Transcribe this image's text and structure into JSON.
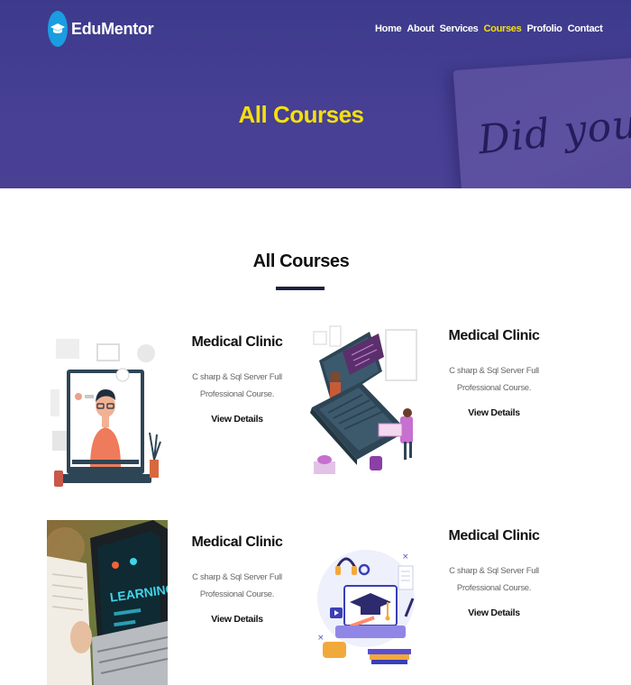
{
  "brand": {
    "name": "EduMentor"
  },
  "nav": {
    "items": [
      {
        "label": "Home",
        "active": false
      },
      {
        "label": "About",
        "active": false
      },
      {
        "label": "Services",
        "active": false
      },
      {
        "label": "Courses",
        "active": true
      },
      {
        "label": "Profolio",
        "active": false
      },
      {
        "label": "Contact",
        "active": false
      }
    ]
  },
  "hero": {
    "title": "All Courses",
    "background_text": "Did you kno"
  },
  "section": {
    "title": "All Courses"
  },
  "courses": [
    {
      "title": "Medical Clinic",
      "description": "C sharp & Sql Server Full Professional Course.",
      "link": "View Details",
      "image": "video-call-illustration"
    },
    {
      "title": "Medical Clinic",
      "description": "C sharp & Sql Server Full Professional Course.",
      "link": "View Details",
      "image": "online-teacher-laptop-illustration"
    },
    {
      "title": "Medical Clinic",
      "description": "C sharp & Sql Server Full Professional Course.",
      "link": "View Details",
      "image": "learning-laptop-photo"
    },
    {
      "title": "Medical Clinic",
      "description": "C sharp & Sql Server Full Professional Course.",
      "link": "View Details",
      "image": "graduation-cap-laptop-illustration"
    }
  ],
  "colors": {
    "hero_bg": "#463f93",
    "accent_yellow": "#f5e00d",
    "brand_blue": "#1a9de1",
    "rule": "#1a2240"
  }
}
